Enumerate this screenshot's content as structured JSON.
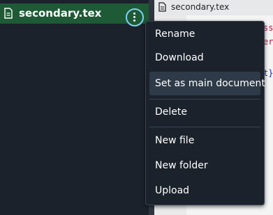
{
  "file_tree": {
    "selected_file": {
      "name": "secondary.tex",
      "icon": "document-icon"
    }
  },
  "editor": {
    "tab": {
      "label": "secondary.tex",
      "icon": "document-icon"
    },
    "code_fragments": [
      "ss",
      "er",
      "t}"
    ]
  },
  "context_menu": {
    "items": [
      {
        "label": "Rename"
      },
      {
        "label": "Download"
      },
      {
        "label": "Set as main document",
        "highlighted": true
      },
      {
        "label": "Delete"
      },
      {
        "label": "New file"
      },
      {
        "label": "New folder"
      },
      {
        "label": "Upload"
      }
    ]
  },
  "colors": {
    "tree_background": "#1b222c",
    "selected_row": "#1e5a36",
    "focus_ring": "#7ed1f0",
    "menu_background": "#1b222c",
    "menu_highlight": "#2f3a48",
    "code_red": "#b5123d",
    "code_blue": "#1f2b8a"
  }
}
